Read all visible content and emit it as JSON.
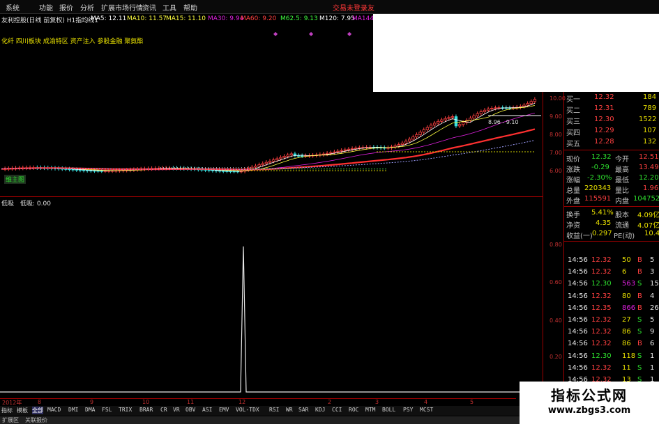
{
  "menu": {
    "items": [
      "系统",
      "功能",
      "报价",
      "分析",
      "扩展市场行情",
      "资讯",
      "工具",
      "帮助"
    ],
    "login": "交易未登录",
    "login2": "友"
  },
  "ma_line": {
    "title": "友利控股(日线 前复权) H1指均线1",
    "values": [
      {
        "label": "MA5: 12.11",
        "color": "#ffffff"
      },
      {
        "label": "MA10: 11.57",
        "color": "#ffff40"
      },
      {
        "label": "MA15: 11.10",
        "color": "#ffff40"
      },
      {
        "label": "MA30: 9.94",
        "color": "#e020e0"
      },
      {
        "label": "MA60: 9.20",
        "color": "#ff4040"
      },
      {
        "label": "M62.5: 9.13",
        "color": "#40ff40"
      },
      {
        "label": "M120: 7.95",
        "color": "#ffffff"
      },
      {
        "label": "MA144",
        "color": "#e020e0"
      }
    ]
  },
  "concept_text": "化纤 四川板块 成渝特区 资产注入 参股金融 聚氨酯",
  "chart_labels": {
    "main_tag": "维主图",
    "annotation": "8.96 - 9.10",
    "osc_label": "低吸",
    "osc_value": "低吸: 0.00"
  },
  "price_ticks": [
    "10.00",
    "9.00",
    "8.00",
    "7.00",
    "6.00"
  ],
  "osc_ticks": [
    "0.80",
    "0.60",
    "0.40",
    "0.20"
  ],
  "order_book": [
    {
      "label": "买一",
      "price": "12.32",
      "vol": "184"
    },
    {
      "label": "买二",
      "price": "12.31",
      "vol": "789"
    },
    {
      "label": "买三",
      "price": "12.30",
      "vol": "1522"
    },
    {
      "label": "买四",
      "price": "12.29",
      "vol": "107"
    },
    {
      "label": "买五",
      "price": "12.28",
      "vol": "132"
    }
  ],
  "quote": {
    "xianjia_label": "现价",
    "xianjia": "12.32",
    "jinkai_label": "今开",
    "jinkai": "12.51",
    "zhangdie_label": "涨跌",
    "zhangdie": "-0.29",
    "zuigao_label": "最高",
    "zuigao": "13.49",
    "zhangfu_label": "涨幅",
    "zhangfu": "-2.30%",
    "zuidi_label": "最低",
    "zuidi": "12.20",
    "zongliang_label": "总量",
    "zongliang": "220343",
    "liangbi_label": "量比",
    "liangbi": "1.96",
    "waipan_label": "外盘",
    "waipan": "115591",
    "neipan_label": "内盘",
    "neipan": "104752",
    "huanshou_label": "换手",
    "huanshou": "5.41%",
    "guben_label": "股本",
    "guben": "4.09亿",
    "jingzi_label": "净资",
    "jingzi": "4.35",
    "liutong_label": "流通",
    "liutong": "4.07亿",
    "shouyi_label": "收益(一)",
    "shouyi": "0.297",
    "pe_label": "PE(动)",
    "pe": "10.4"
  },
  "ticks": [
    {
      "time": "14:56",
      "price": "12.32",
      "vol": "50",
      "bs": "B",
      "n": "5"
    },
    {
      "time": "14:56",
      "price": "12.32",
      "vol": "6",
      "bs": "B",
      "n": "3"
    },
    {
      "time": "14:56",
      "price": "12.30",
      "vol": "563",
      "bs": "S",
      "n": "15"
    },
    {
      "time": "14:56",
      "price": "12.32",
      "vol": "80",
      "bs": "B",
      "n": "4"
    },
    {
      "time": "14:56",
      "price": "12.35",
      "vol": "866",
      "bs": "B",
      "n": "26"
    },
    {
      "time": "14:56",
      "price": "12.32",
      "vol": "27",
      "bs": "S",
      "n": "5"
    },
    {
      "time": "14:56",
      "price": "12.32",
      "vol": "86",
      "bs": "S",
      "n": "9"
    },
    {
      "time": "14:56",
      "price": "12.32",
      "vol": "86",
      "bs": "B",
      "n": "6"
    },
    {
      "time": "14:56",
      "price": "12.30",
      "vol": "118",
      "bs": "S",
      "n": "1"
    },
    {
      "time": "14:56",
      "price": "12.32",
      "vol": "11",
      "bs": "S",
      "n": "1"
    },
    {
      "time": "14:56",
      "price": "12.32",
      "vol": "13",
      "bs": "S",
      "n": "1"
    }
  ],
  "time_axis": [
    "2012年",
    "8",
    "9",
    "10",
    "11",
    "12",
    "2",
    "3",
    "4",
    "5"
  ],
  "tabs": [
    "指标",
    "模板",
    "全部",
    "MACD",
    "DMI",
    "DMA",
    "FSL",
    "TRIX",
    "BRAR",
    "CR",
    "VR",
    "OBV",
    "ASI",
    "EMV",
    "VOL-TDX",
    "RSI",
    "WR",
    "SAR",
    "KDJ",
    "CCI",
    "ROC",
    "MTM",
    "BOLL",
    "PSY",
    "MCST"
  ],
  "bottom_bar": [
    "扩展区",
    "关联报价"
  ],
  "watermark": {
    "title": "指标公式网",
    "url": "www.zbgs3.com"
  },
  "colors": {
    "up": "#ff4040",
    "down": "#2ee02e",
    "axis": "#a00000"
  }
}
